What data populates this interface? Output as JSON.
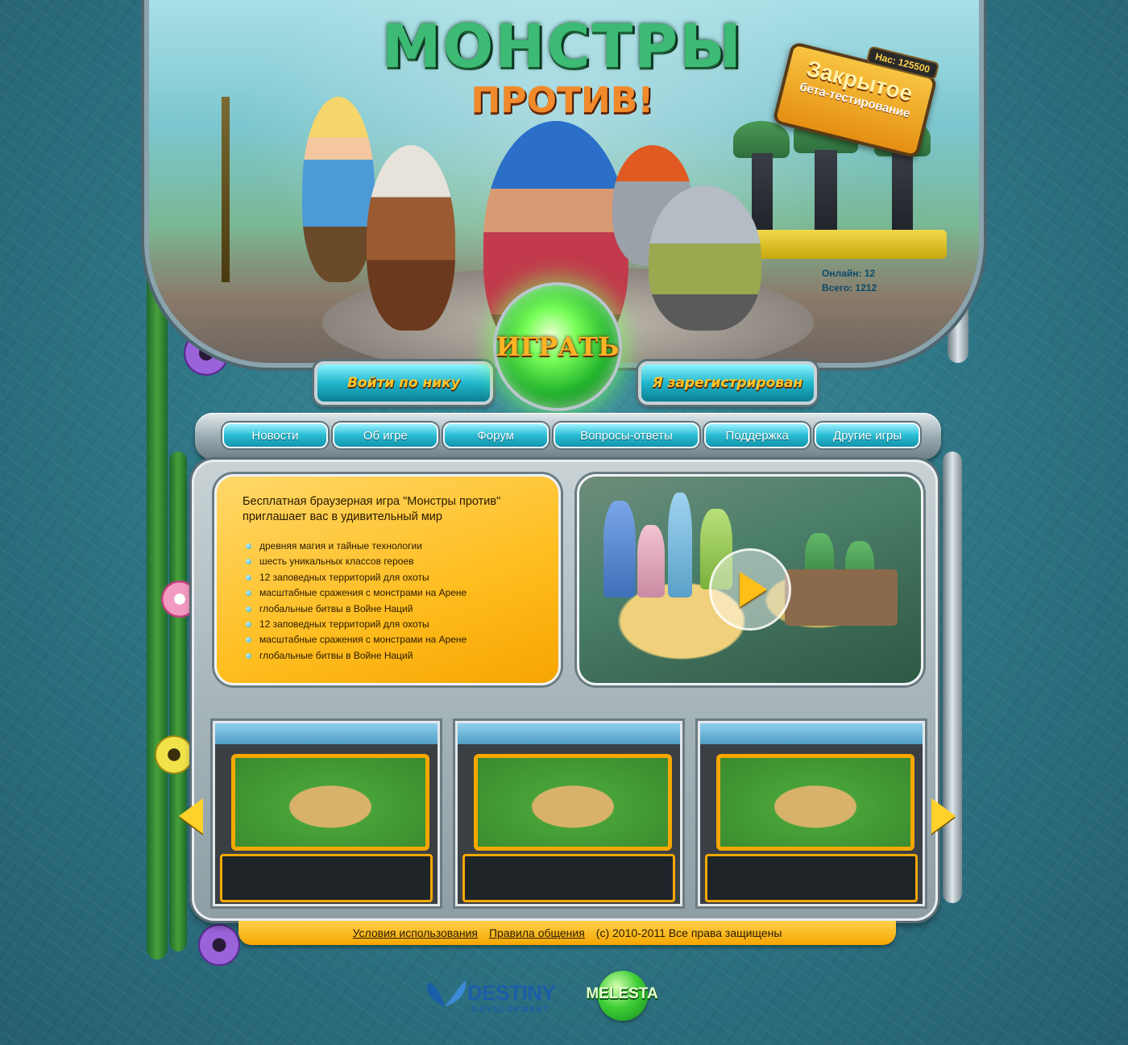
{
  "colors": {
    "accent_gold": "#ffc52a",
    "nav_cyan": "#29bcd3",
    "play_green": "#3fcf37",
    "panel_orange": "#ffbd1f"
  },
  "header": {
    "logo_title": "МОНСТРЫ",
    "logo_subtitle": "ПРОТИВ!",
    "beta_badge": {
      "count_text": "Нас: 125500",
      "title": "Закрытое",
      "subtitle": "бета-тестирование"
    },
    "stats": {
      "online": "Онлайн: 12",
      "total": "Всего: 1212"
    },
    "play_button": "ИГРАТЬ",
    "login_nick_button": "Войти по нику",
    "registered_button": "Я зарегистрирован"
  },
  "nav": {
    "items": [
      {
        "label": "Новости"
      },
      {
        "label": "Об игре"
      },
      {
        "label": "Форум"
      },
      {
        "label": "Вопросы-ответы"
      },
      {
        "label": "Поддержка"
      },
      {
        "label": "Другие игры"
      }
    ]
  },
  "info": {
    "lead": "Бесплатная браузерная игра \"Монстры против\" приглашает вас в удивительный мир",
    "features": [
      "древняя магия и тайные технологии",
      "шесть уникальных классов героев",
      "12 заповедных территорий для охоты",
      "масштабные сражения с монстрами на Арене",
      "глобальные битвы в Войне Наций",
      "12 заповедных территорий для охоты",
      "масштабные сражения с монстрами на Арене",
      "глобальные битвы в Войне Наций"
    ]
  },
  "video": {
    "icon": "play-icon"
  },
  "screenshots": {
    "arrow_left_icon": "arrow-left-icon",
    "arrow_right_icon": "arrow-right-icon"
  },
  "footer": {
    "terms_link": "Условия использования",
    "rules_link": "Правила общения",
    "copyright": "(c) 2010-2011 Все права защищены"
  },
  "logos": {
    "developer_name": "DESTINY",
    "developer_sub": "DEVELOPMENT",
    "publisher_name": "MELESTA"
  }
}
